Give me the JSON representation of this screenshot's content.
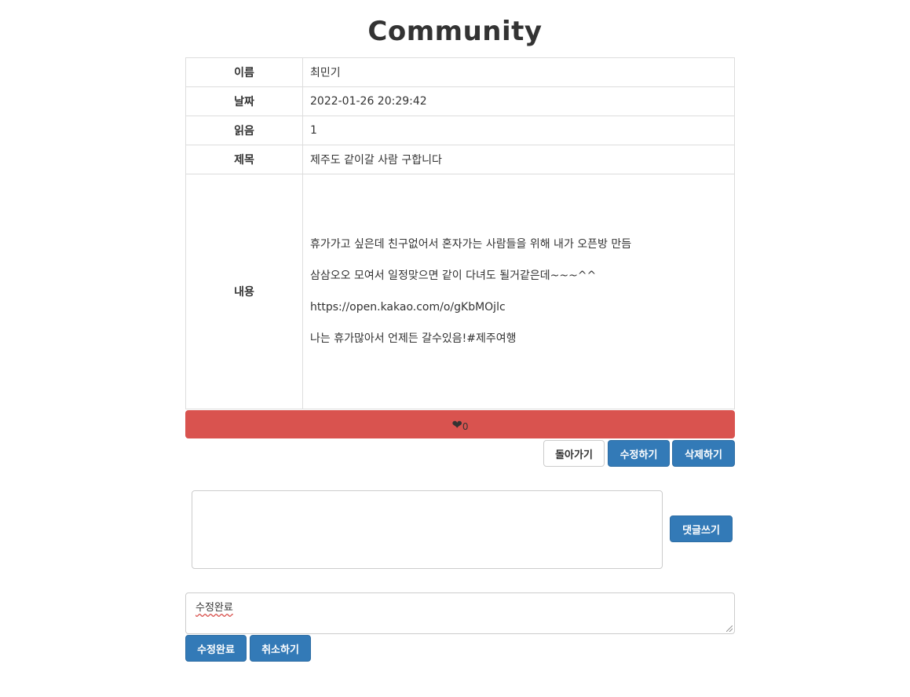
{
  "page": {
    "title": "Community"
  },
  "post": {
    "name_label": "이름",
    "name_value": "최민기",
    "date_label": "날짜",
    "date_value": "2022-01-26 20:29:42",
    "views_label": "읽음",
    "views_value": "1",
    "subject_label": "제목",
    "subject_value": "제주도 같이갈 사람 구합니다",
    "content_label": "내용",
    "content_lines": [
      "휴가가고 싶은데 친구없어서 혼자가는 사람들을 위해 내가 오픈방 만듬",
      "삼삼오오 모여서 일정맞으면 같이 다녀도 될거같은데~~~^^",
      "https://open.kakao.com/o/gKbMOjlc",
      "나는 휴가많아서 언제든 갈수있음!#제주여행"
    ]
  },
  "like": {
    "icon": "heart-icon",
    "count": "0",
    "color": "#d9534f"
  },
  "actions": {
    "back": "돌아가기",
    "edit": "수정하기",
    "delete": "삭제하기"
  },
  "comment": {
    "value": "",
    "submit": "댓글쓰기"
  },
  "edit_comment": {
    "value": "수정완료",
    "confirm": "수정완료",
    "cancel": "취소하기"
  },
  "colors": {
    "primary": "#337ab7",
    "danger": "#d9534f"
  }
}
